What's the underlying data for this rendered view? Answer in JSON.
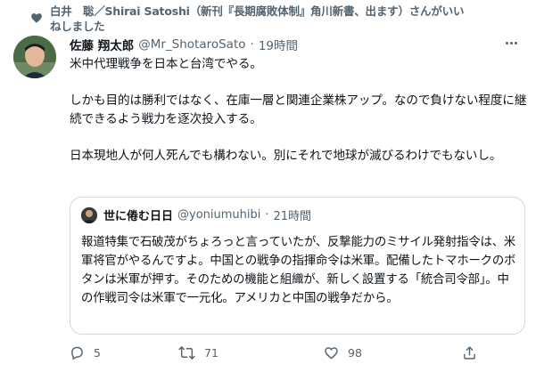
{
  "social_context": {
    "icon": "heart-icon",
    "text": "白井　聡／Shirai Satoshi（新刊『長期腐敗体制』角川新書、出ます）さんがいいねしました"
  },
  "tweet": {
    "display_name": "佐藤 翔太郎",
    "handle": "@Mr_ShotaroSato",
    "separator": "·",
    "time": "19時間",
    "paragraphs": [
      "米中代理戦争を日本と台湾でやる。",
      "しかも目的は勝利ではなく、在庫一層と関連企業株アップ。なので負けない程度に継続できるよう戦力を逐次投入する。",
      "日本現地人が何人死んでも構わない。別にそれで地球が滅びるわけでもないし。"
    ]
  },
  "quoted_tweet": {
    "display_name": "世に倦む日日",
    "handle": "@yoniumuhibi",
    "separator": "·",
    "time": "21時間",
    "text": "報道特集で石破茂がちょろっと言っていたが、反撃能力のミサイル発射指令は、米軍将官がやるんですよ。中国との戦争の指揮命令は米軍。配備したトマホークのボタンは米軍が押す。そのための機能と組織が、新しく設置する「統合司令部」。中の作戦司令は米軍で一元化。アメリカと中国の戦争だから。"
  },
  "actions": {
    "reply_count": "5",
    "retweet_count": "71",
    "like_count": "98"
  },
  "colors": {
    "text_primary": "#0f1419",
    "text_secondary": "#536471",
    "border": "#cfd9de"
  }
}
